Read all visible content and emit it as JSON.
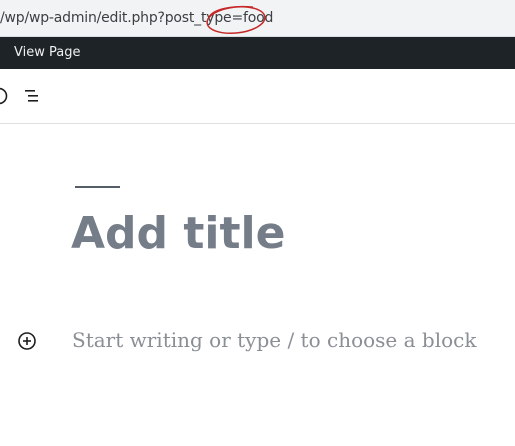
{
  "browser": {
    "url": "/wp/wp-admin/edit.php?post_type=food"
  },
  "admin_bar": {
    "view_page_label": "View Page"
  },
  "editor": {
    "toolbar_icons": [
      "info-icon",
      "list-view-icon"
    ],
    "title_placeholder": "Add title",
    "block_placeholder": "Start writing or type / to choose a block",
    "add_block_icon": "plus-circle-icon"
  },
  "colors": {
    "admin_bar_bg": "#1d2327",
    "title": "#757d88",
    "annotation": "#c62828"
  }
}
